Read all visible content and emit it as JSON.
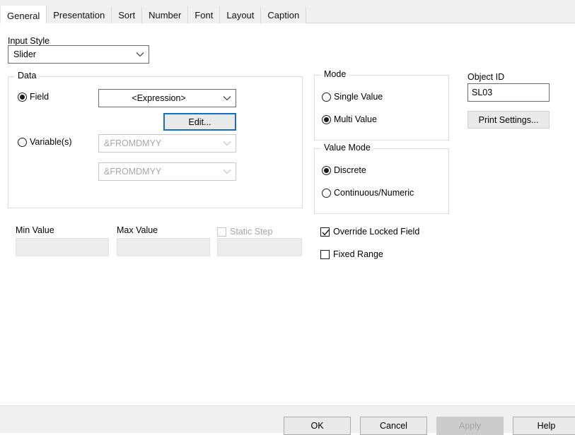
{
  "dialog": {
    "tabs": [
      {
        "label": "General",
        "active": true
      },
      {
        "label": "Presentation",
        "active": false
      },
      {
        "label": "Sort",
        "active": false
      },
      {
        "label": "Number",
        "active": false
      },
      {
        "label": "Font",
        "active": false
      },
      {
        "label": "Layout",
        "active": false
      },
      {
        "label": "Caption",
        "active": false
      }
    ]
  },
  "input_style": {
    "label": "Input Style",
    "value": "Slider"
  },
  "data_group": {
    "title": "Data",
    "field_radio": "Field",
    "field_value": "<Expression>",
    "edit_button": "Edit...",
    "variable_radio": "Variable(s)",
    "variable1_value": "&FROMDMYY",
    "variable2_value": "&FROMDMYY"
  },
  "mode_group": {
    "title": "Mode",
    "single_value": "Single Value",
    "multi_value": "Multi Value"
  },
  "value_mode_group": {
    "title": "Value Mode",
    "discrete": "Discrete",
    "continuous": "Continuous/Numeric"
  },
  "object_id": {
    "label": "Object ID",
    "value": "SL03",
    "print_settings_button": "Print Settings..."
  },
  "range": {
    "min_label": "Min Value",
    "min_value": "",
    "max_label": "Max Value",
    "max_value": "",
    "static_step_label": "Static Step",
    "static_step_value": ""
  },
  "options": {
    "override_locked_field": "Override Locked Field",
    "fixed_range": "Fixed Range"
  },
  "footer": {
    "ok": "OK",
    "cancel": "Cancel",
    "apply": "Apply",
    "help": "Help"
  },
  "colors": {
    "focus_blue": "#1b6fb0",
    "tabstrip_bg": "#f0f0f0",
    "footer_bg": "#f0f0f0",
    "disabled_text": "#a6a6a6"
  }
}
